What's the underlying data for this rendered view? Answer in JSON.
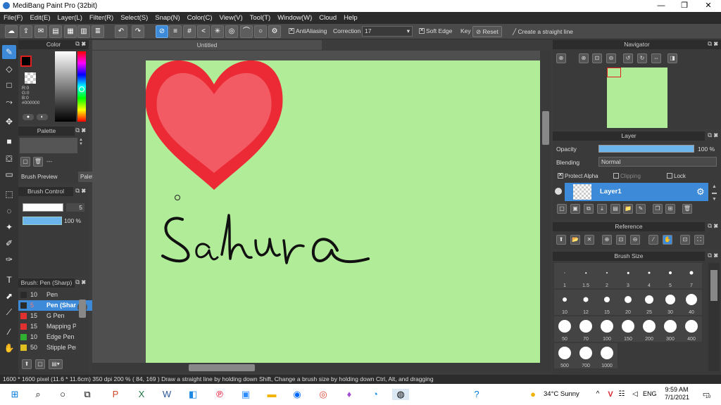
{
  "window": {
    "title": "MediBang Paint Pro (32bit)",
    "minimize": "—",
    "maximize": "❐",
    "close": "✕"
  },
  "menu": [
    "File(F)",
    "Edit(E)",
    "Layer(L)",
    "Filter(R)",
    "Select(S)",
    "Snap(N)",
    "Color(C)",
    "View(V)",
    "Tool(T)",
    "Window(W)",
    "Cloud",
    "Help"
  ],
  "toolbar": {
    "antialiasing": "AntiAliasing",
    "correction_label": "Correction",
    "correction_value": "17",
    "soft_edge": "Soft Edge",
    "key": "Key",
    "reset": "Reset",
    "straight_line": "Create a straight line"
  },
  "color_panel": {
    "title": "Color",
    "r": "R:0",
    "g": "G:0",
    "b": "B:0",
    "hex": "#000000"
  },
  "palette_panel": {
    "title": "Palette",
    "value": "---",
    "tab_preview": "Brush Preview",
    "tab_palette": "Palette"
  },
  "brush_control": {
    "title": "Brush Control",
    "size": "5",
    "opacity": "100 %"
  },
  "brush_list": {
    "title": "Brush: Pen (Sharp)",
    "items": [
      {
        "size": "10",
        "name": "Pen",
        "color": "#2a2a2a"
      },
      {
        "size": "5",
        "name": "Pen (Sharp)",
        "color": "#2a2a2a"
      },
      {
        "size": "15",
        "name": "G Pen",
        "color": "#e03030"
      },
      {
        "size": "15",
        "name": "Mapping Pen",
        "color": "#e03030"
      },
      {
        "size": "10",
        "name": "Edge Pen",
        "color": "#30b030"
      },
      {
        "size": "50",
        "name": "Stipple Pen",
        "color": "#e0c020"
      }
    ]
  },
  "canvas": {
    "tab": "Untitled",
    "text": "Sahura",
    "paper_color": "#b1ec98"
  },
  "navigator": {
    "title": "Navigator"
  },
  "layer_panel": {
    "title": "Layer",
    "opacity_label": "Opacity",
    "opacity_value": "100 %",
    "blending_label": "Blending",
    "blending_value": "Normal",
    "protect_alpha": "Protect Alpha",
    "clipping": "Clipping",
    "lock": "Lock",
    "layer_name": "Layer1"
  },
  "reference": {
    "title": "Reference"
  },
  "brush_size": {
    "title": "Brush Size",
    "sizes": [
      "1",
      "1.5",
      "2",
      "3",
      "4",
      "5",
      "7",
      "10",
      "12",
      "15",
      "20",
      "25",
      "30",
      "40",
      "50",
      "70",
      "100",
      "150",
      "200",
      "300",
      "400",
      "500",
      "700",
      "1000"
    ]
  },
  "status": "1600 * 1600 pixel   (11.6 * 11.6cm)   350 dpi   200 %   ( 84, 169 )   Draw a straight line by holding down Shift, Change a brush size by holding down Ctrl, Alt, and dragging",
  "taskbar": {
    "weather": "34°C  Sunny",
    "lang": "ENG",
    "time": "9:59 AM",
    "date": "7/1/2021",
    "notif": "10"
  }
}
